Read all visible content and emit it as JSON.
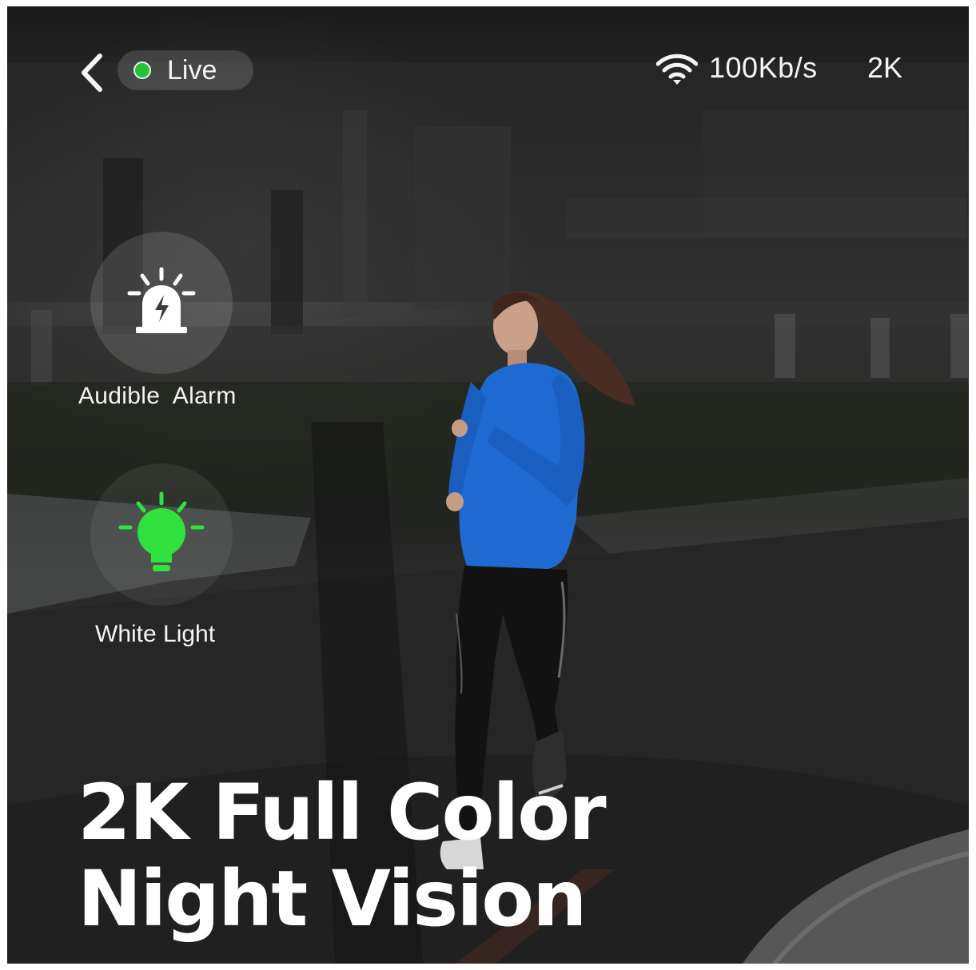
{
  "topbar": {
    "status_label": "Live",
    "bitrate": "100Kb/s",
    "resolution": "2K",
    "status_color": "#22c232"
  },
  "controls": {
    "alarm_label": "Audible  Alarm",
    "light_label": "White Light",
    "light_active_color": "#2fe23d"
  },
  "headline": {
    "line1": "2K Full Color",
    "line2": "Night Vision"
  },
  "icons": [
    "back-chevron-icon",
    "wifi-icon",
    "siren-icon",
    "light-bulb-icon"
  ]
}
